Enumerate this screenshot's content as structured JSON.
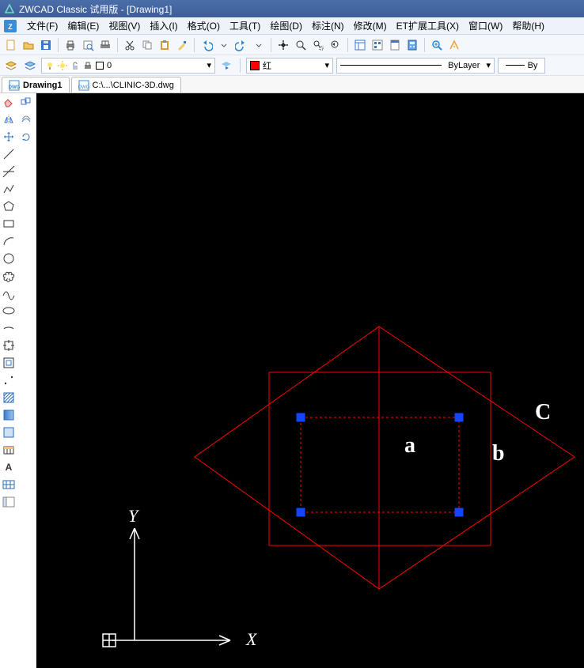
{
  "title": "ZWCAD Classic 试用版 - [Drawing1]",
  "menus": {
    "file": "文件(F)",
    "edit": "编辑(E)",
    "view": "视图(V)",
    "insert": "插入(I)",
    "format": "格式(O)",
    "tools": "工具(T)",
    "draw": "绘图(D)",
    "annotate": "标注(N)",
    "modify": "修改(M)",
    "et": "ET扩展工具(X)",
    "window": "窗口(W)",
    "help": "帮助(H)"
  },
  "layer": {
    "name": "0"
  },
  "color": {
    "label": "红",
    "hex": "#ff0000"
  },
  "linetype": "ByLayer",
  "lineweight": "By",
  "tabs": {
    "active": "Drawing1",
    "other": "C:\\...\\CLINIC-3D.dwg"
  },
  "annotations": {
    "a": "a",
    "b": "b",
    "c": "C",
    "x": "X",
    "y": "Y"
  }
}
